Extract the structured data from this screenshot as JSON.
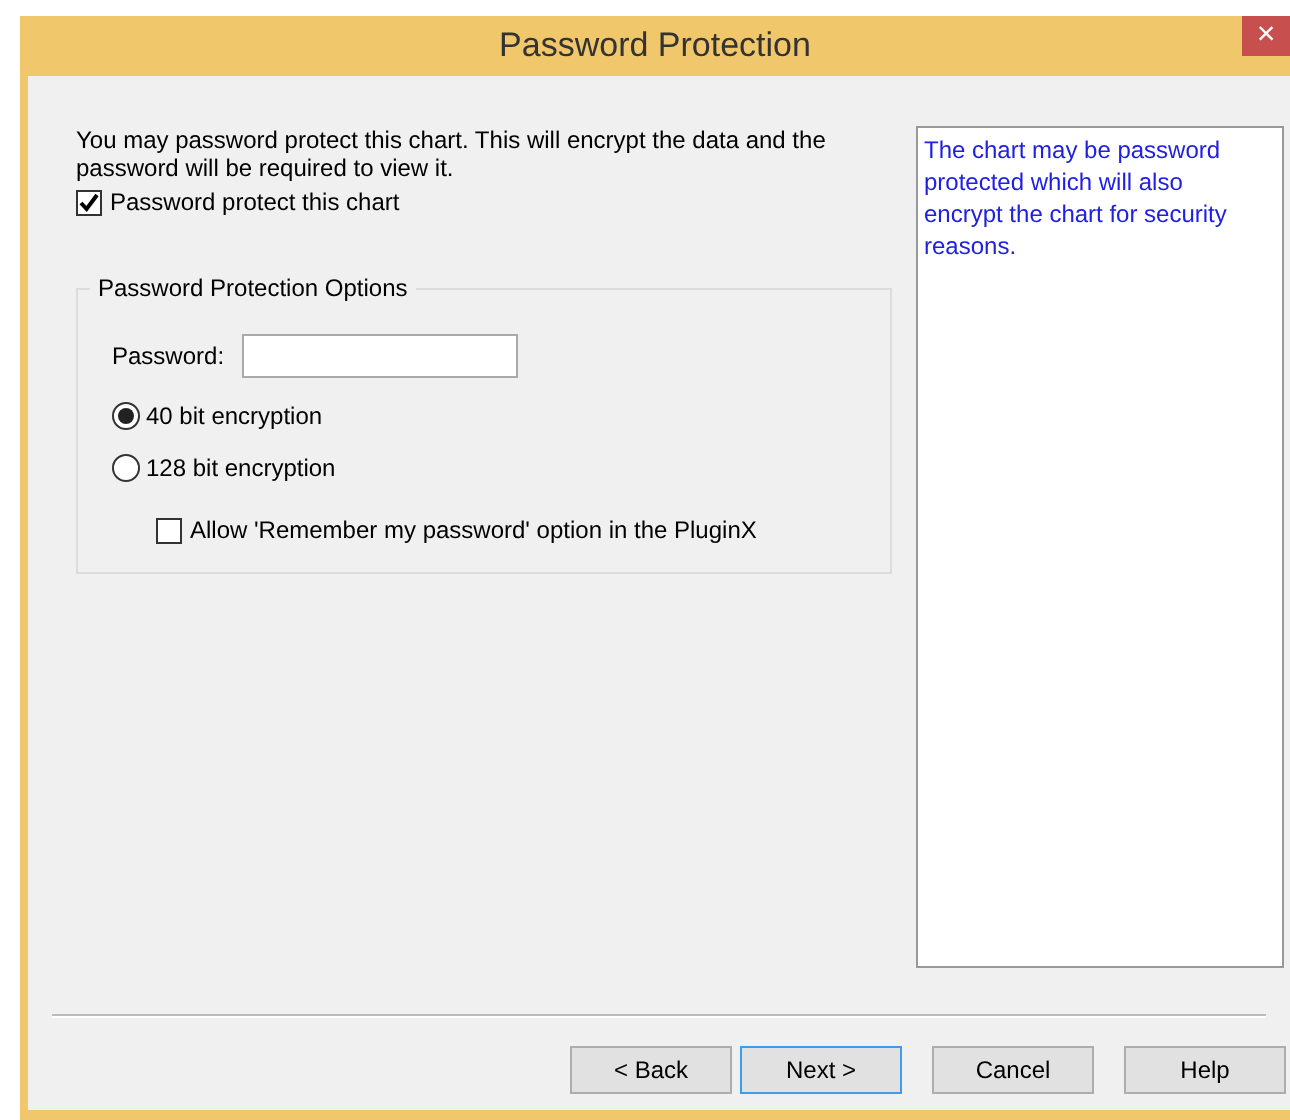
{
  "window": {
    "title": "Password Protection",
    "close_label": "×"
  },
  "intro": "You may password protect this chart. This will encrypt the data and the password will be required to view it.",
  "protect_checkbox": {
    "label": "Password protect this chart",
    "checked": true
  },
  "options_group": {
    "title": "Password Protection Options",
    "password_label": "Password:",
    "encryption": [
      {
        "label": "40 bit encryption",
        "selected": true
      },
      {
        "label": "128 bit encryption",
        "selected": false
      }
    ],
    "remember_checkbox": {
      "label": "Allow 'Remember my password' option in the PluginX",
      "checked": false
    }
  },
  "help_text": "The chart may be password protected which will also encrypt the chart for security reasons.",
  "buttons": [
    {
      "label": "< Back",
      "focused": false
    },
    {
      "label": "Next >",
      "focused": true
    },
    {
      "label": "Cancel",
      "focused": false
    },
    {
      "label": "Help",
      "focused": false
    }
  ]
}
